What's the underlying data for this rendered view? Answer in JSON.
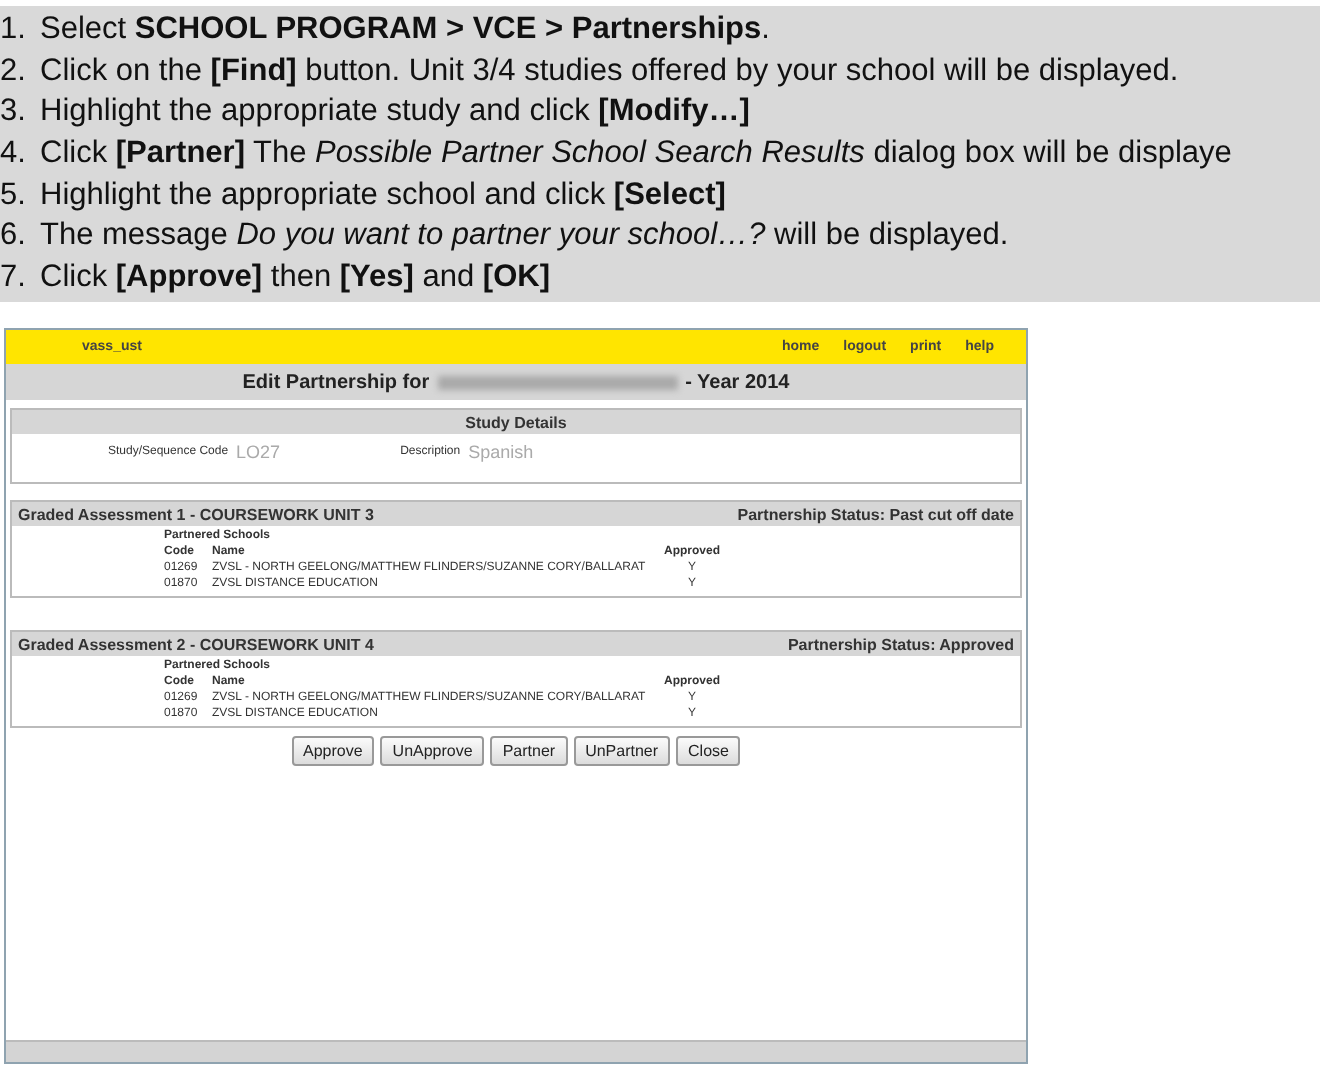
{
  "instructions": [
    {
      "number": "1.",
      "text": "Select **SCHOOL PROGRAM > VCE > Partnerships**."
    },
    {
      "number": "2.",
      "text": "Click on the **[Find]** button. Unit 3/4 studies offered by your school will be displayed."
    },
    {
      "number": "3.",
      "text": "Highlight the appropriate study and click **[Modify…]**"
    },
    {
      "number": "4.",
      "text": "Click **[Partner]** The *Possible Partner School Search Results* dialog box will be displaye"
    },
    {
      "number": "5.",
      "text": "Highlight the appropriate school and click **[Select]**"
    },
    {
      "number": "6.",
      "text": "The message *Do you want to partner your school…?* will be displayed."
    },
    {
      "number": "7.",
      "text": "Click **[Approve]** then **[Yes]** and **[OK]**"
    }
  ],
  "screenshot": {
    "user": "vass_ust",
    "nav_links": [
      "home",
      "logout",
      "print",
      "help"
    ],
    "title_prefix": "Edit Partnership for",
    "title_suffix": "- Year 2014",
    "study_details": {
      "heading": "Study Details",
      "code_label": "Study/Sequence Code",
      "code": "LO27",
      "description_label": "Description",
      "description": "Spanish"
    },
    "assessments": [
      {
        "title": "Graded Assessment 1 - COURSEWORK UNIT 3",
        "status": "Partnership Status: Past cut off date",
        "subheading": "Partnered Schools",
        "columns": [
          "Code",
          "Name",
          "Approved"
        ],
        "rows": [
          {
            "code": "01269",
            "name": "ZVSL - NORTH GEELONG/MATTHEW FLINDERS/SUZANNE CORY/BALLARAT",
            "approved": "Y"
          },
          {
            "code": "01870",
            "name": "ZVSL DISTANCE EDUCATION",
            "approved": "Y"
          }
        ]
      },
      {
        "title": "Graded Assessment 2 - COURSEWORK UNIT 4",
        "status": "Partnership Status: Approved",
        "subheading": "Partnered Schools",
        "columns": [
          "Code",
          "Name",
          "Approved"
        ],
        "rows": [
          {
            "code": "01269",
            "name": "ZVSL - NORTH GEELONG/MATTHEW FLINDERS/SUZANNE CORY/BALLARAT",
            "approved": "Y"
          },
          {
            "code": "01870",
            "name": "ZVSL DISTANCE EDUCATION",
            "approved": "Y"
          }
        ]
      }
    ],
    "buttons": [
      "Approve",
      "UnApprove",
      "Partner",
      "UnPartner",
      "Close"
    ]
  }
}
